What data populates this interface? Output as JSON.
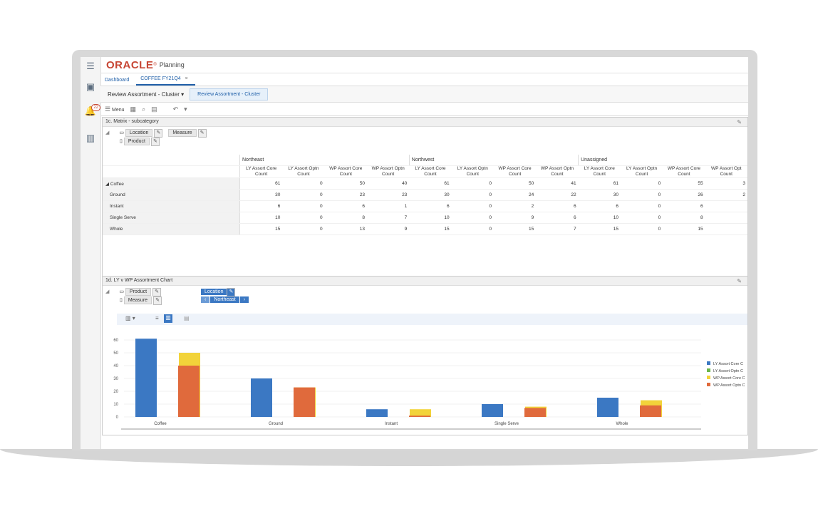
{
  "app": {
    "brand": "ORACLE",
    "brand_mark": "®",
    "product": "Planning"
  },
  "sidebar": {
    "notifications": "22"
  },
  "tabs": [
    {
      "label": "Dashboard"
    },
    {
      "label": "COFFEE FY21Q4",
      "close": "×"
    }
  ],
  "view": {
    "selector": "Review Assortment - Cluster",
    "chip": "Review Assortment - Cluster"
  },
  "toolbar": {
    "menu": "Menu"
  },
  "matrix": {
    "title": "1c. Matrix - subcategory",
    "pivot": {
      "location": "Location",
      "measure": "Measure",
      "product": "Product"
    },
    "groups": [
      "Northeast",
      "Northwest",
      "Unassigned"
    ],
    "columns": [
      "LY Assort Core Count",
      "LY Assort Optn Count",
      "WP Assort Core Count",
      "WP Assort Optn Count",
      "LY Assort Core Count",
      "LY Assort Optn Count",
      "WP Assort Core Count",
      "WP Assort Optn Count",
      "LY Assort Core Count",
      "LY Assort Optn Count",
      "WP Assort Core Count",
      "WP Assort Opt Count"
    ],
    "rows": [
      {
        "label": "Coffee",
        "values": [
          "61",
          "0",
          "50",
          "40",
          "61",
          "0",
          "50",
          "41",
          "61",
          "0",
          "55",
          "3"
        ]
      },
      {
        "label": "Ground",
        "values": [
          "30",
          "0",
          "23",
          "23",
          "30",
          "0",
          "24",
          "22",
          "30",
          "0",
          "26",
          "2"
        ]
      },
      {
        "label": "Instant",
        "values": [
          "6",
          "0",
          "6",
          "1",
          "6",
          "0",
          "2",
          "6",
          "6",
          "0",
          "6",
          ""
        ]
      },
      {
        "label": "Single Serve",
        "values": [
          "10",
          "0",
          "8",
          "7",
          "10",
          "0",
          "9",
          "6",
          "10",
          "0",
          "8",
          ""
        ]
      },
      {
        "label": "Whole",
        "values": [
          "15",
          "0",
          "13",
          "9",
          "15",
          "0",
          "15",
          "7",
          "15",
          "0",
          "15",
          ""
        ]
      }
    ]
  },
  "chartpanel": {
    "title": "1d. LY v WP Assortment Chart",
    "pivot": {
      "product": "Product",
      "measure": "Measure",
      "location": "Location",
      "location_value": "Northeast"
    }
  },
  "chart_data": {
    "type": "bar",
    "categories": [
      "Coffee",
      "Ground",
      "Instant",
      "Single Serve",
      "Whole"
    ],
    "series": [
      {
        "name": "LY Assort Core C",
        "color": "#3b78c3",
        "values": [
          61,
          30,
          6,
          10,
          15
        ]
      },
      {
        "name": "LY Assort Optn C",
        "color": "#6bb64a",
        "values": [
          0,
          0,
          0,
          0,
          0
        ]
      },
      {
        "name": "WP Assort Core C",
        "color": "#f2d33a",
        "values": [
          50,
          23,
          6,
          8,
          13
        ]
      },
      {
        "name": "WP Assort Optn C",
        "color": "#e06a3c",
        "values": [
          40,
          23,
          1,
          7,
          9
        ]
      }
    ],
    "yticks": [
      "0",
      "10",
      "20",
      "30",
      "40",
      "50",
      "60"
    ],
    "ylim": [
      0,
      65
    ],
    "grid": true,
    "legend": "right"
  }
}
